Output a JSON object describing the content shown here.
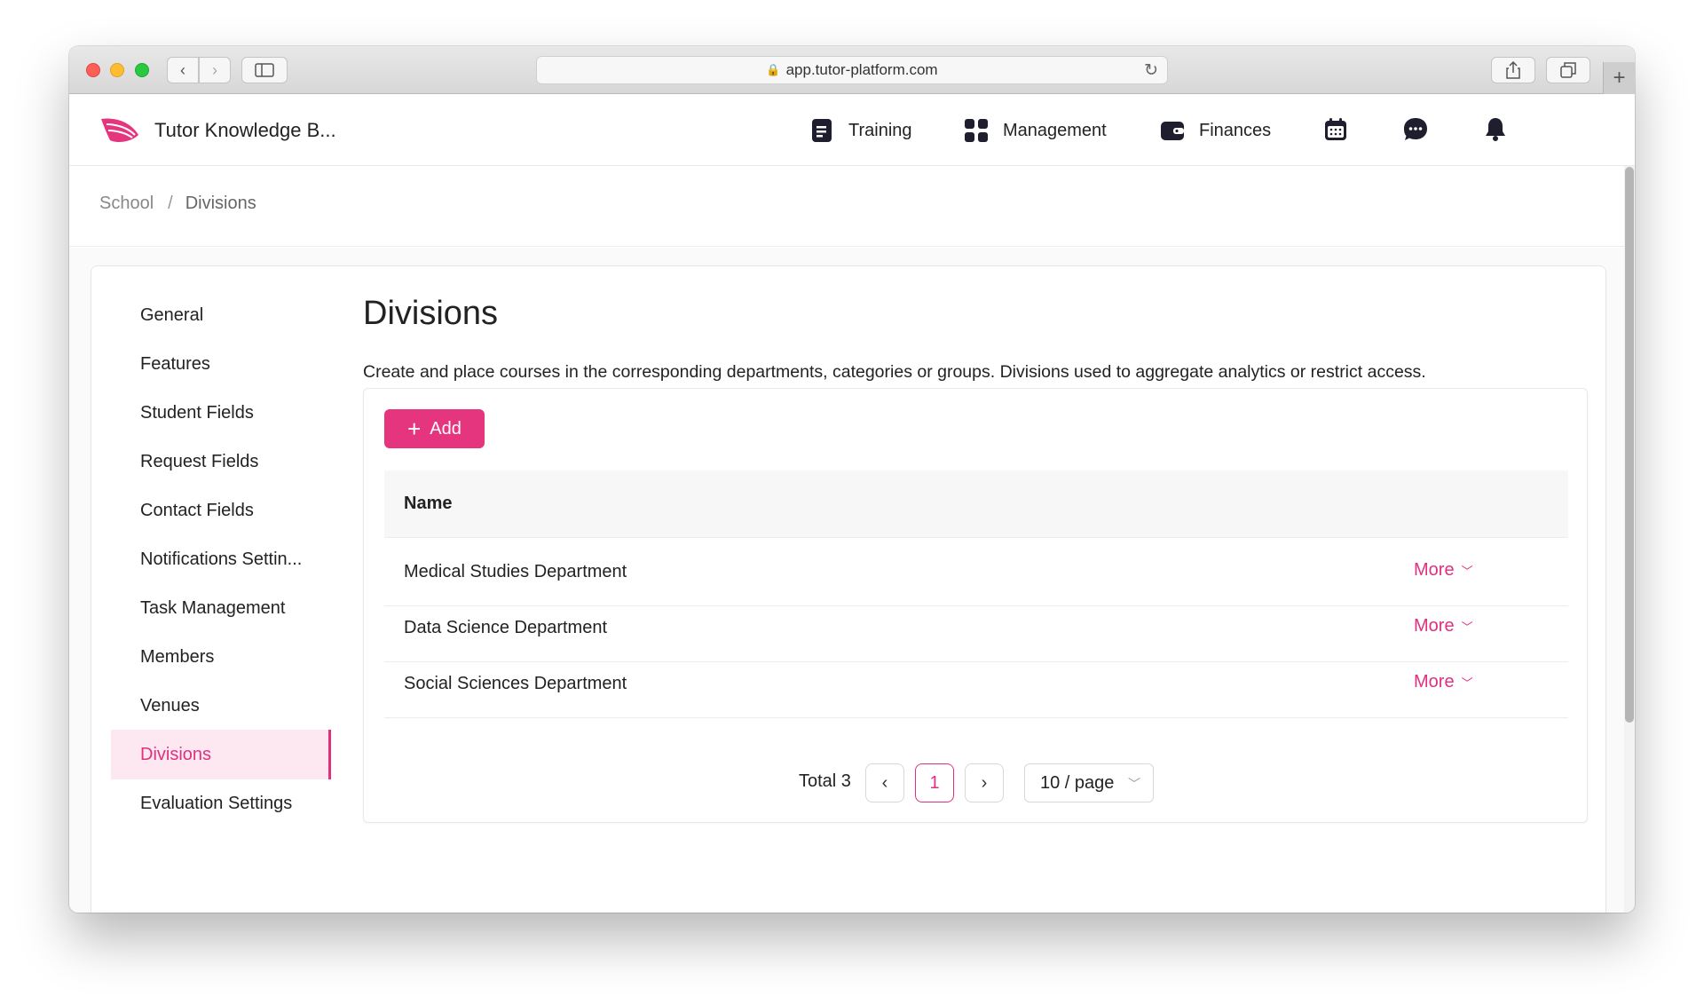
{
  "browser": {
    "url": "app.tutor-platform.com"
  },
  "header": {
    "app_title": "Tutor Knowledge B...",
    "nav": [
      {
        "label": "Training",
        "icon": "book-icon"
      },
      {
        "label": "Management",
        "icon": "grid-icon"
      },
      {
        "label": "Finances",
        "icon": "wallet-icon"
      }
    ],
    "icons": [
      "calendar-icon",
      "chat-icon",
      "bell-icon"
    ]
  },
  "breadcrumb": {
    "parent": "School",
    "separator": "/",
    "current": "Divisions"
  },
  "sidebar": {
    "items": [
      {
        "label": "General"
      },
      {
        "label": "Features"
      },
      {
        "label": "Student Fields"
      },
      {
        "label": "Request Fields"
      },
      {
        "label": "Contact Fields"
      },
      {
        "label": "Notifications Settin..."
      },
      {
        "label": "Task Management"
      },
      {
        "label": "Members"
      },
      {
        "label": "Venues"
      },
      {
        "label": "Divisions",
        "active": true
      },
      {
        "label": "Evaluation Settings"
      }
    ]
  },
  "main": {
    "title": "Divisions",
    "description": "Create and place courses in the corresponding departments, categories or groups. Divisions used to aggregate analytics or restrict access.",
    "add_label": "Add",
    "table": {
      "columns": [
        "Name"
      ],
      "rows": [
        {
          "name": "Medical Studies Department",
          "action": "More"
        },
        {
          "name": "Data Science Department",
          "action": "More"
        },
        {
          "name": "Social Sciences Department",
          "action": "More"
        }
      ]
    },
    "pagination": {
      "total_label": "Total 3",
      "current_page": "1",
      "page_size": "10 / page"
    }
  },
  "colors": {
    "accent": "#e6357f",
    "accent_bg": "#fde8f1"
  }
}
